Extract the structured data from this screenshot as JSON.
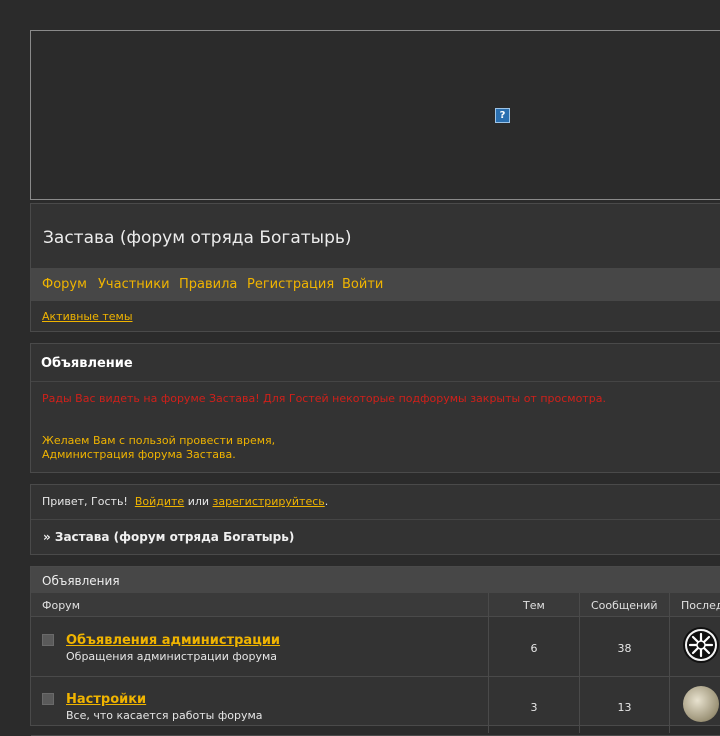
{
  "banner": {
    "broken_image_glyph": "?"
  },
  "header": {
    "title": "Застава (форум отряда Богатырь)",
    "nav": [
      "Форум",
      "Участники",
      "Правила",
      "Регистрация",
      "Войти"
    ],
    "active_topics": "Активные темы"
  },
  "announcement": {
    "heading": "Объявление",
    "red_text": "Рады Вас видеть на форуме Застава! Для Гостей некоторые подфорумы закрыты от просмотра.",
    "line1": "Желаем Вам с пользой провести время,",
    "line2": "Администрация форума Застава."
  },
  "greeting": {
    "hello": "Привет, Гость!",
    "login_link": "Войдите",
    "or": "или",
    "register_link": "зарегистрируйтесь",
    "period": ".",
    "breadcrumb": "» Застава (форум отряда Богатырь)"
  },
  "forum": {
    "category": "Объявления",
    "columns": {
      "forum": "Форум",
      "topics": "Тем",
      "posts": "Сообщений",
      "last": "Послед"
    },
    "rows": [
      {
        "name": "Объявления администрации",
        "desc": "Обращения администрации форума",
        "topics": "6",
        "posts": "38",
        "avatar": "black-emblem"
      },
      {
        "name": "Настройки",
        "desc": "Все, что касается работы форума",
        "topics": "3",
        "posts": "13",
        "avatar": "photo"
      }
    ]
  },
  "colors": {
    "accent": "#f0b400",
    "alert": "#d0201a",
    "background": "#2b2b2b",
    "panel": "#333333"
  }
}
